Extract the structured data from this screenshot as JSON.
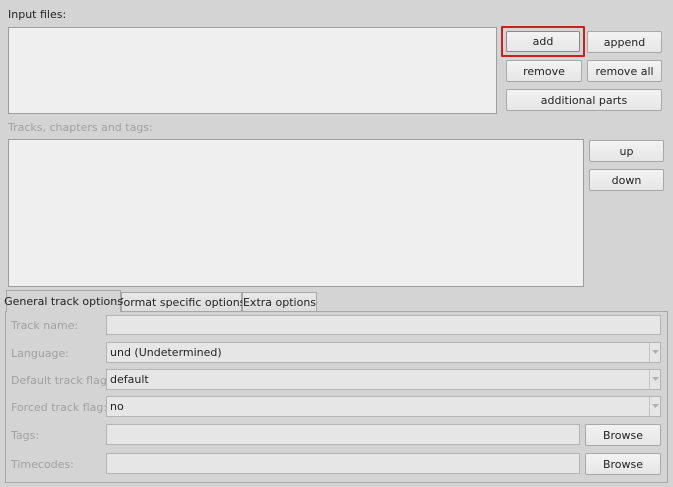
{
  "input_files": {
    "label": "Input files:",
    "buttons": {
      "add": "add",
      "append": "append",
      "remove": "remove",
      "remove_all": "remove all",
      "additional_parts": "additional parts"
    }
  },
  "tracks": {
    "label": "Tracks, chapters and tags:",
    "buttons": {
      "up": "up",
      "down": "down"
    }
  },
  "tabs": [
    {
      "label": "General track options",
      "active": true
    },
    {
      "label": "Format specific options",
      "active": false
    },
    {
      "label": "Extra options",
      "active": false
    }
  ],
  "general_options": {
    "track_name": {
      "label": "Track name:",
      "value": ""
    },
    "language": {
      "label": "Language:",
      "value": "und (Undetermined)"
    },
    "default_track_flag": {
      "label": "Default track flag:",
      "value": "default"
    },
    "forced_track_flag": {
      "label": "Forced track flag:",
      "value": "no"
    },
    "tags": {
      "label": "Tags:",
      "value": "",
      "browse_label": "Browse"
    },
    "timecodes": {
      "label": "Timecodes:",
      "value": "",
      "browse_label": "Browse"
    }
  },
  "colors": {
    "background": "#d4d4d4",
    "focus_ring": "#cc1f1f",
    "disabled_text": "#a0a0a0"
  }
}
